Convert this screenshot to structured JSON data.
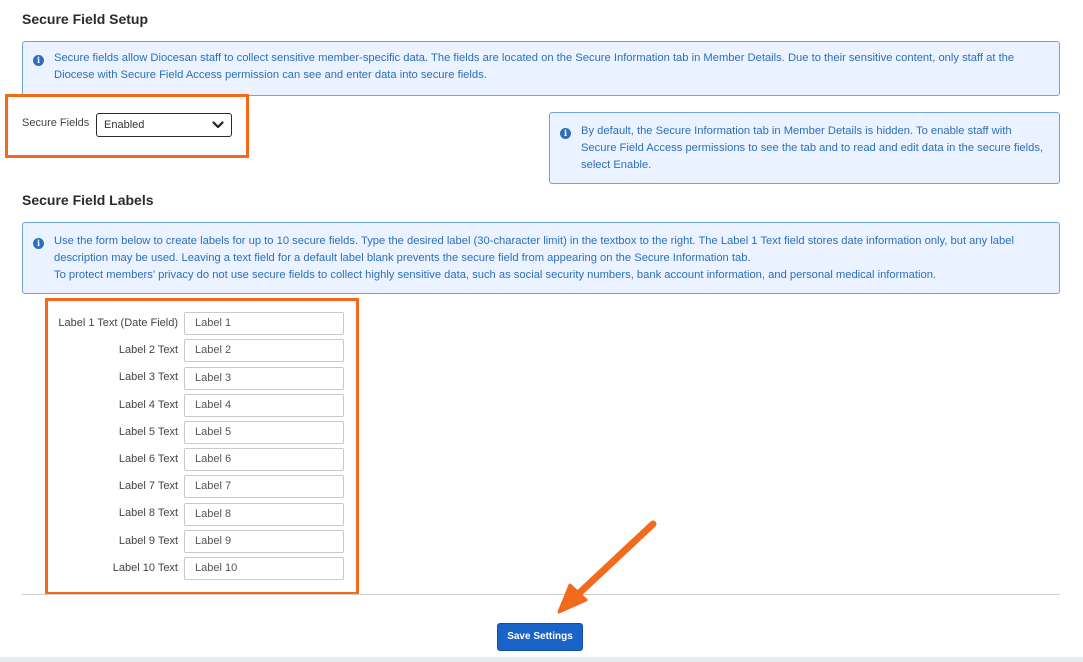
{
  "setup": {
    "title": "Secure Field Setup",
    "info_text": "Secure fields allow Diocesan staff to collect sensitive member-specific data. The fields are located on the Secure Information tab in Member Details. Due to their sensitive content, only staff at the Diocese with Secure Field Access permission can see and enter data into secure fields.",
    "field_label": "Secure Fields",
    "selected_value": "Enabled",
    "side_info_text": "By default, the Secure Information tab in Member Details is hidden. To enable staff with Secure Field Access permissions to see the tab and to read and edit data in the secure fields, select Enable."
  },
  "labels_section": {
    "title": "Secure Field Labels",
    "info_line1": "Use the form below to create labels for up to 10 secure fields. Type the desired label (30-character limit) in the textbox to the right. The Label 1 Text field stores date information only, but any label description may be used. Leaving a text field for a default label blank prevents the secure field from appearing on the Secure Information tab.",
    "info_line2": "To protect members' privacy do not use secure fields to collect highly sensitive data, such as social security numbers, bank account information, and personal medical information.",
    "rows": [
      {
        "label": "Label 1 Text (Date Field)",
        "value": "Label 1"
      },
      {
        "label": "Label 2 Text",
        "value": "Label 2"
      },
      {
        "label": "Label 3 Text",
        "value": "Label 3"
      },
      {
        "label": "Label 4 Text",
        "value": "Label 4"
      },
      {
        "label": "Label 5 Text",
        "value": "Label 5"
      },
      {
        "label": "Label 6 Text",
        "value": "Label 6"
      },
      {
        "label": "Label 7 Text",
        "value": "Label 7"
      },
      {
        "label": "Label 8 Text",
        "value": "Label 8"
      },
      {
        "label": "Label 9 Text",
        "value": "Label 9"
      },
      {
        "label": "Label 10 Text",
        "value": "Label 10"
      }
    ]
  },
  "actions": {
    "save_label": "Save Settings"
  },
  "colors": {
    "info_background": "#eaf3ff",
    "info_text": "#2d6fb8",
    "highlight": "#f26b1d",
    "primary_button": "#1a63c9"
  },
  "icons": [
    "info-icon",
    "chevron-down-icon",
    "arrow-annotation"
  ]
}
